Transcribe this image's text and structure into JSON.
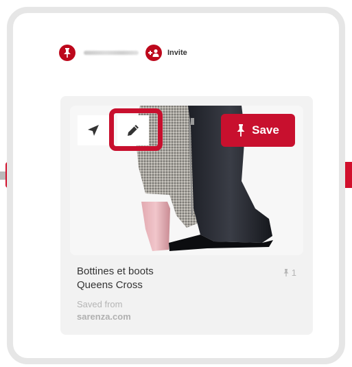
{
  "board": {
    "owner_name": "",
    "invite_label": "Invite"
  },
  "pin": {
    "save_label": "Save",
    "title_line1": "Bottines et boots",
    "title_line2": "Queens Cross",
    "repin_count": "1",
    "saved_from_label": "Saved from",
    "source_domain": "sarenza.com"
  },
  "icons": {
    "header_pin": "pin-icon",
    "invite": "add-person-icon",
    "send": "send-icon",
    "edit": "pencil-icon",
    "save": "pin-icon",
    "repin": "pin-icon"
  },
  "colors": {
    "brand_red": "#bd081c",
    "highlight_red": "#c8102e",
    "card_bg": "#f2f2f2",
    "muted_text": "#b5b5b5"
  }
}
